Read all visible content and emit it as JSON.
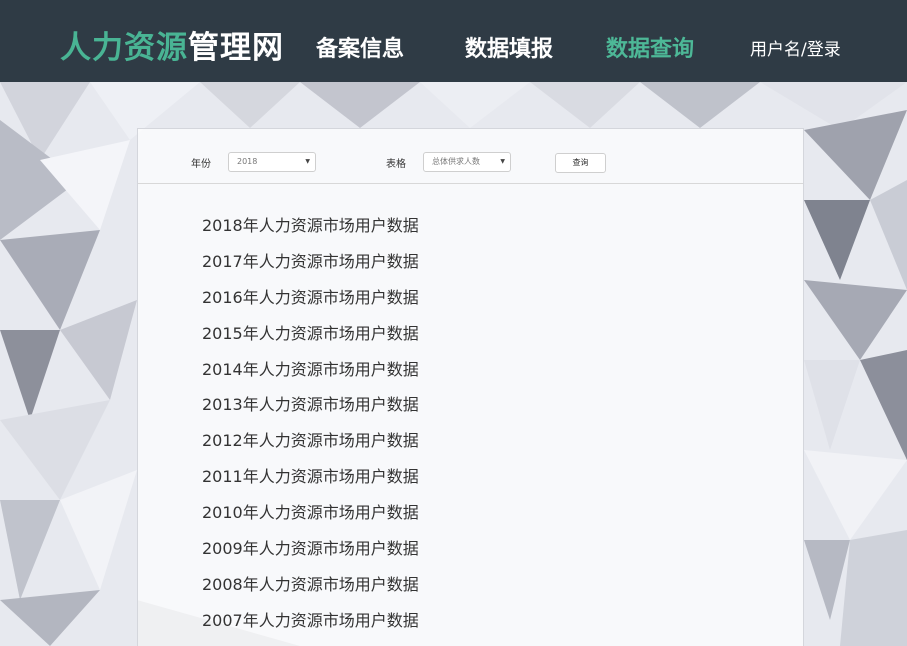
{
  "header": {
    "logo_accent": "人力资源",
    "logo_rest": "管理网",
    "nav": [
      {
        "label": "备案信息"
      },
      {
        "label": "数据填报"
      },
      {
        "label": "数据查询"
      }
    ],
    "user_login": "用户名/登录",
    "accent_color": "#4db897"
  },
  "filters": {
    "year_label": "年份",
    "year_value": "2018",
    "table_label": "表格",
    "table_value": "总体供求人数",
    "query_button": "查询"
  },
  "records": [
    "2018年人力资源市场用户数据",
    "2017年人力资源市场用户数据",
    "2016年人力资源市场用户数据",
    "2015年人力资源市场用户数据",
    "2014年人力资源市场用户数据",
    "2013年人力资源市场用户数据",
    "2012年人力资源市场用户数据",
    "2011年人力资源市场用户数据",
    "2010年人力资源市场用户数据",
    "2009年人力资源市场用户数据",
    "2008年人力资源市场用户数据",
    "2007年人力资源市场用户数据"
  ]
}
